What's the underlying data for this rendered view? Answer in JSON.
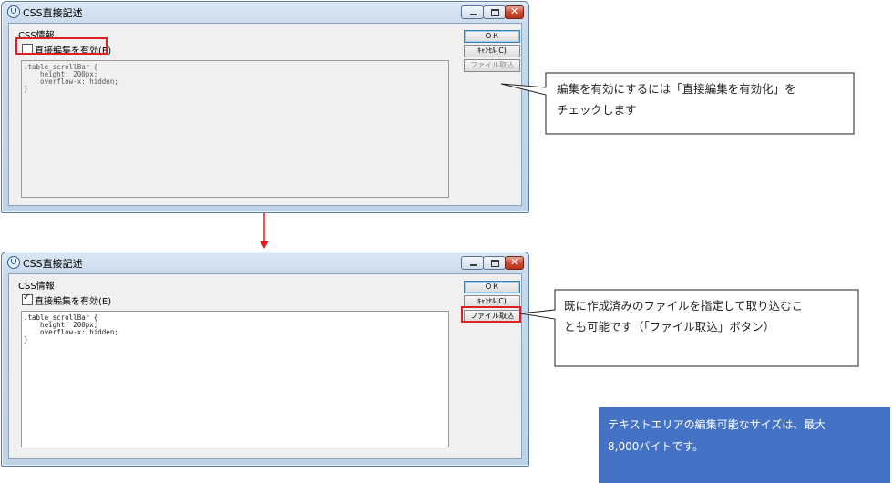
{
  "dialog": {
    "title": "CSS直接記述",
    "section_label": "CSS情報",
    "checkbox_label": "直接編集を有効(E)",
    "ok_label": "ＯＫ",
    "cancel_label": "ｷｬﾝｾﾙ(C)",
    "file_import_label": "ファイル取込",
    "css_text": ".table_scrollBar {\n    height: 200px;\n    overflow-x: hidden;\n}"
  },
  "before": {
    "checkbox_checked": false,
    "editor_enabled": false,
    "file_button_enabled": false
  },
  "after": {
    "checkbox_checked": true,
    "editor_enabled": true,
    "file_button_enabled": true
  },
  "callouts": {
    "enable_edit": {
      "line1": "編集を有効にするには「直接編集を有効化」を",
      "line2": "チェックします"
    },
    "file_import": {
      "line1": "既に作成済みのファイルを指定して取り込むこ",
      "line2": "とも可能です（「ファイル取込」ボタン）"
    }
  },
  "note": {
    "line1": "テキストエリアの編集可能なサイズは、最大",
    "line2": "8,000バイトです。"
  },
  "colors": {
    "highlight": "#e02020",
    "arrow": "#e02020",
    "note_bg": "#4472c4",
    "note_text": "#ffffff"
  }
}
